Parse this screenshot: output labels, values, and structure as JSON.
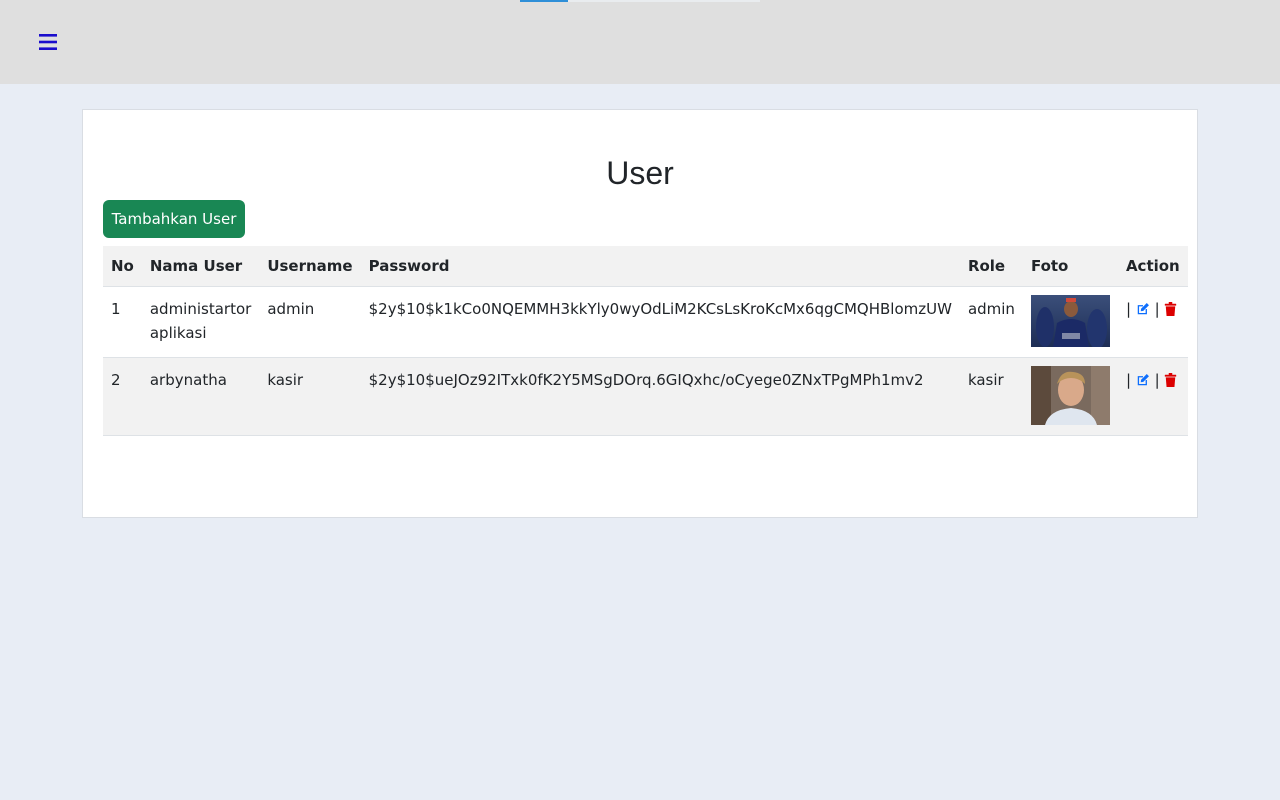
{
  "nav": {
    "menu_icon": "bars-icon",
    "accent_color": "#1a0dcc"
  },
  "page": {
    "title": "User"
  },
  "toolbar": {
    "add_label": "Tambahkan User",
    "add_color": "#198754"
  },
  "table": {
    "headers": {
      "no": "No",
      "nama_user": "Nama User",
      "username": "Username",
      "password": "Password",
      "role": "Role",
      "foto": "Foto",
      "action": "Action"
    },
    "rows": [
      {
        "no": "1",
        "nama_user": "administartor aplikasi",
        "username": "admin",
        "password": "$2y$10$k1kCo0NQEMMH3kkYly0wyOdLiM2KCsLsKroKcMx6qgCMQHBlomzUW",
        "role": "admin",
        "sep1": "|",
        "sep2": "|"
      },
      {
        "no": "2",
        "nama_user": "arbynatha",
        "username": "kasir",
        "password": "$2y$10$ueJOz92ITxk0fK2Y5MSgDOrq.6GIQxhc/oCyege0ZNxTPgMPh1mv2",
        "role": "kasir",
        "sep1": "|",
        "sep2": "|"
      }
    ],
    "action_icons": {
      "edit": "edit-icon",
      "delete": "trash-icon",
      "edit_color": "#0d6efd",
      "delete_color": "#dc0000"
    }
  }
}
